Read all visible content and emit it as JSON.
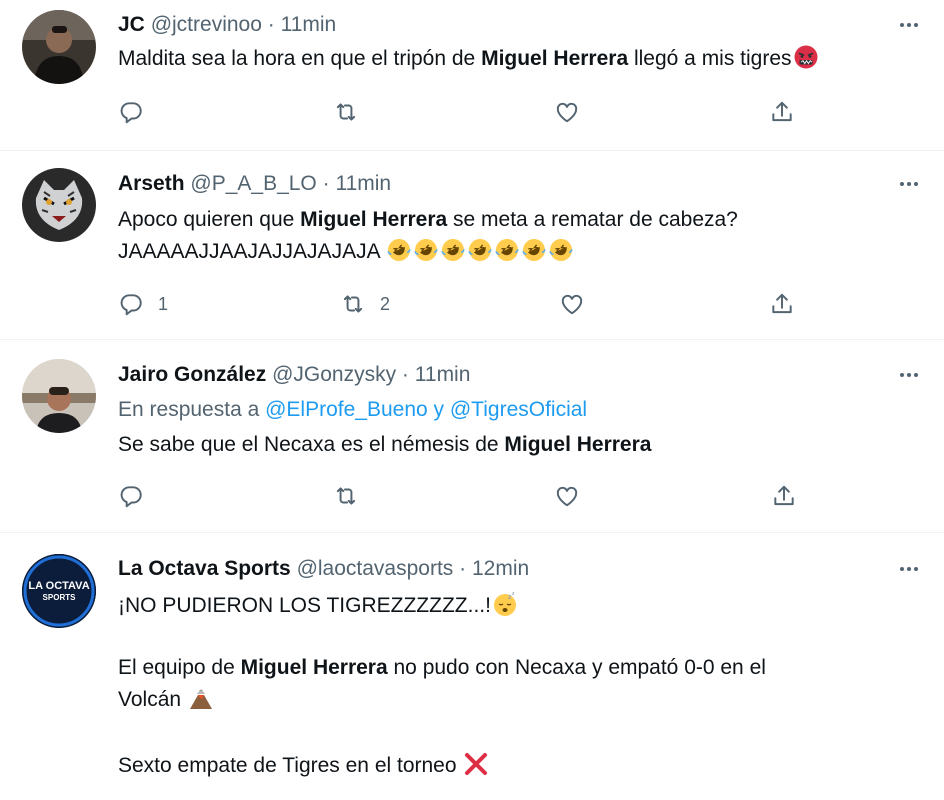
{
  "tweets": [
    {
      "name": "JC",
      "handle": "@jctrevinoo",
      "dot": "·",
      "time": "11min",
      "text_before": "Maldita sea la hora en que el tripón de ",
      "text_bold": "Miguel Herrera",
      "text_after": " llegó a mis tigres",
      "emojis": [
        "angry-face-emoji"
      ],
      "reply_count": "",
      "retweet_count": "",
      "like_count": ""
    },
    {
      "name": "Arseth",
      "handle": "@P_A_B_LO",
      "dot": "·",
      "time": "11min",
      "text_before": "Apoco quieren que ",
      "text_bold": "Miguel Herrera",
      "text_after": " se meta a rematar de cabeza?",
      "line2": "JAAAAAJJAAJAJJAJAJAJA",
      "emojis": [
        "rofl-emoji",
        "rofl-emoji",
        "rofl-emoji",
        "rofl-emoji",
        "rofl-emoji",
        "rofl-emoji",
        "rofl-emoji"
      ],
      "reply_count": "1",
      "retweet_count": "2",
      "like_count": ""
    },
    {
      "name": "Jairo González",
      "handle": "@JGonzysky",
      "dot": "·",
      "time": "11min",
      "reply_prefix": "En respuesta a ",
      "reply_user1": "@ElProfe_Bueno",
      "reply_and": " y ",
      "reply_user2": "@TigresOficial",
      "text_before": "Se sabe que el Necaxa es el némesis de ",
      "text_bold": "Miguel Herrera",
      "reply_count": "",
      "retweet_count": "",
      "like_count": ""
    },
    {
      "name": "La Octava Sports",
      "handle": "@laoctavasports",
      "dot": "·",
      "time": "12min",
      "avatar_text1": "LA OCTAVA",
      "avatar_text2": "SPORTS",
      "line1": "¡NO PUDIERON LOS TIGREZZZZZZ...!",
      "p2_before": "El equipo de ",
      "p2_bold": "Miguel Herrera",
      "p2_after": " no pudo con Necaxa y empató 0-0 en el",
      "p2_line2": "Volcán",
      "p3": "Sexto empate de Tigres en el torneo",
      "emojis": [
        "sleeping-face-emoji",
        "volcano-emoji",
        "cross-mark-emoji"
      ]
    }
  ],
  "colors": {
    "text": "#0f1419",
    "secondary": "#536471",
    "link": "#1d9bf0",
    "divider": "#eff3f4"
  },
  "icons": [
    "reply-icon",
    "retweet-icon",
    "like-icon",
    "share-icon",
    "more-icon"
  ]
}
